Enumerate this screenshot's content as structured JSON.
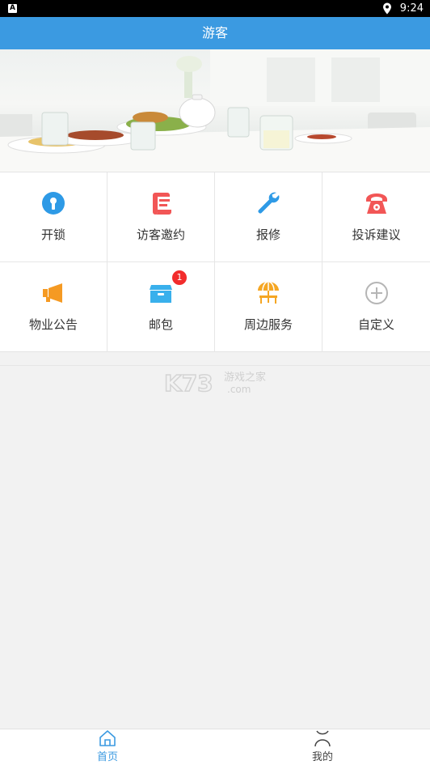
{
  "status_bar": {
    "time": "9:24",
    "notification_letter": "A"
  },
  "header": {
    "title": "游客"
  },
  "banner": {
    "page_count": 3,
    "active_page": 1
  },
  "grid": {
    "row1": [
      {
        "label": "开锁",
        "icon": "keyhole-icon",
        "color": "#2e9ae6"
      },
      {
        "label": "访客邀约",
        "icon": "visitor-pass-icon",
        "color": "#f25656"
      },
      {
        "label": "报修",
        "icon": "wrench-icon",
        "color": "#2e9ae6"
      },
      {
        "label": "投诉建议",
        "icon": "telephone-icon",
        "color": "#f25656"
      }
    ],
    "row2": [
      {
        "label": "物业公告",
        "icon": "megaphone-icon",
        "color": "#f59a23"
      },
      {
        "label": "邮包",
        "icon": "parcel-box-icon",
        "color": "#39b0ec",
        "badge": "1"
      },
      {
        "label": "周边服务",
        "icon": "market-stall-icon",
        "color": "#f5a623"
      },
      {
        "label": "自定义",
        "icon": "add-circle-icon",
        "color": "#b5b5b5"
      }
    ]
  },
  "watermark": {
    "brand": "K73",
    "text": "游戏之家",
    "domain": ".com"
  },
  "tabbar": {
    "tabs": [
      {
        "label": "首页",
        "icon": "home-icon",
        "active": true
      },
      {
        "label": "我的",
        "icon": "profile-icon",
        "active": false
      }
    ],
    "active_color": "#3b9ae1",
    "inactive_color": "#444444"
  },
  "colors": {
    "primary": "#3b9ae1",
    "badge": "#f22c2c"
  }
}
